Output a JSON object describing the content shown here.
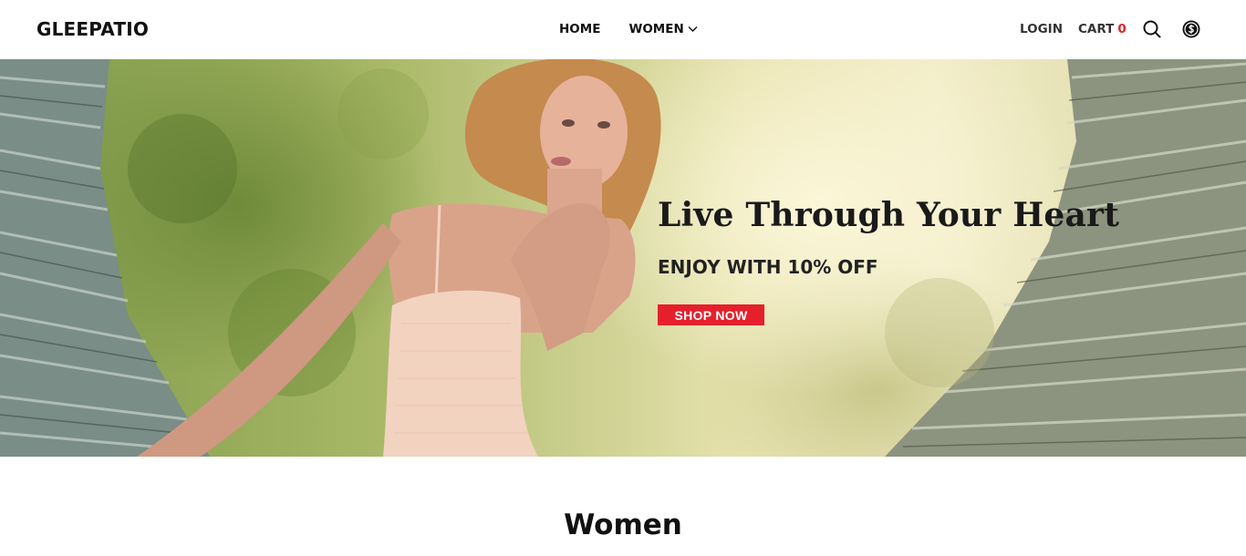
{
  "header": {
    "logo": "GLEEPATIO",
    "nav": [
      {
        "label": "HOME"
      },
      {
        "label": "WOMEN"
      }
    ],
    "login_label": "LOGIN",
    "cart_label": "CART",
    "cart_count": "0",
    "icons": [
      "chevron-down-icon",
      "search-icon",
      "currency-icon"
    ]
  },
  "hero": {
    "title": "Live Through Your Heart",
    "subtitle": "ENJOY WITH 10% OFF",
    "button_label": "SHOP NOW"
  },
  "section": {
    "title": "Women"
  },
  "colors": {
    "accent": "#e5202c",
    "text": "#111111",
    "background": "#ffffff"
  }
}
